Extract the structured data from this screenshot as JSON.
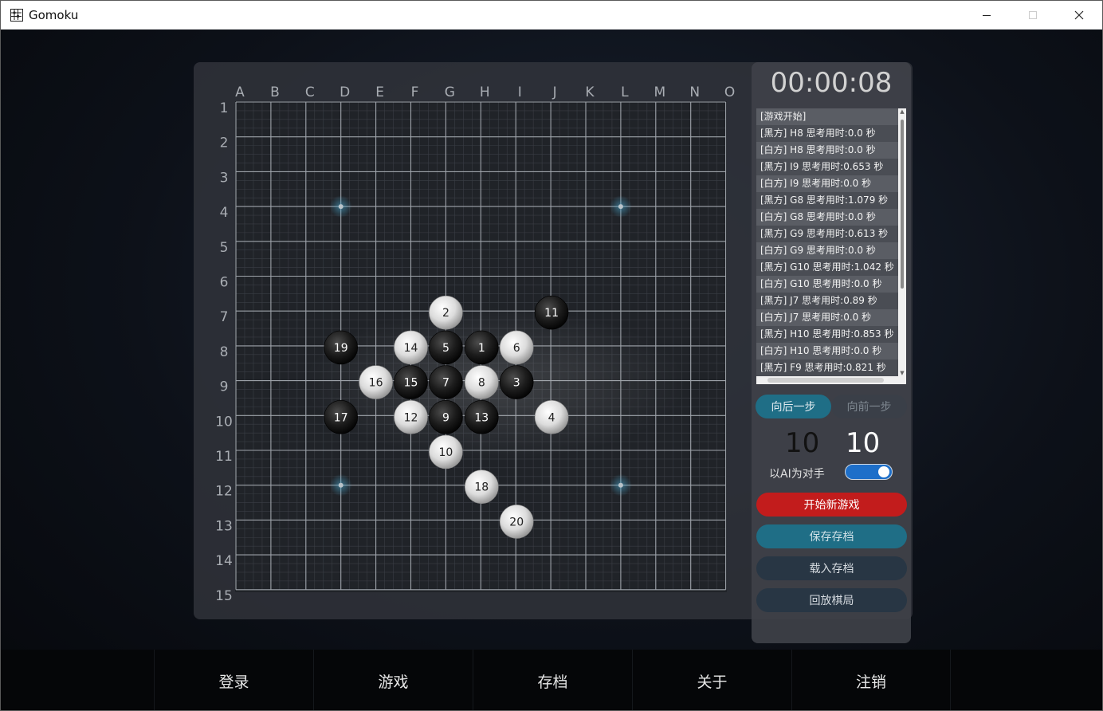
{
  "window": {
    "title": "Gomoku",
    "controls": {
      "minimize": "—",
      "maximize": "☐",
      "close": "✕"
    }
  },
  "board": {
    "columns": [
      "A",
      "B",
      "C",
      "D",
      "E",
      "F",
      "G",
      "H",
      "I",
      "J",
      "K",
      "L",
      "M",
      "N",
      "O"
    ],
    "rows": [
      "1",
      "2",
      "3",
      "4",
      "5",
      "6",
      "7",
      "8",
      "9",
      "10",
      "11",
      "12",
      "13",
      "14",
      "15"
    ],
    "star_points": [
      [
        "D",
        4
      ],
      [
        "L",
        4
      ],
      [
        "D",
        12
      ],
      [
        "L",
        12
      ]
    ],
    "stones": [
      {
        "n": 1,
        "color": "black",
        "col": "H",
        "row": 8
      },
      {
        "n": 2,
        "color": "white",
        "col": "G",
        "row": 7
      },
      {
        "n": 3,
        "color": "black",
        "col": "I",
        "row": 9
      },
      {
        "n": 4,
        "color": "white",
        "col": "J",
        "row": 10
      },
      {
        "n": 5,
        "color": "black",
        "col": "G",
        "row": 8
      },
      {
        "n": 6,
        "color": "white",
        "col": "I",
        "row": 8
      },
      {
        "n": 7,
        "color": "black",
        "col": "G",
        "row": 9
      },
      {
        "n": 8,
        "color": "white",
        "col": "H",
        "row": 9
      },
      {
        "n": 9,
        "color": "black",
        "col": "G",
        "row": 10
      },
      {
        "n": 10,
        "color": "white",
        "col": "G",
        "row": 11
      },
      {
        "n": 11,
        "color": "black",
        "col": "J",
        "row": 7
      },
      {
        "n": 12,
        "color": "white",
        "col": "F",
        "row": 10
      },
      {
        "n": 13,
        "color": "black",
        "col": "H",
        "row": 10
      },
      {
        "n": 14,
        "color": "white",
        "col": "F",
        "row": 8
      },
      {
        "n": 15,
        "color": "black",
        "col": "F",
        "row": 9
      },
      {
        "n": 16,
        "color": "white",
        "col": "E",
        "row": 9
      },
      {
        "n": 17,
        "color": "black",
        "col": "D",
        "row": 10
      },
      {
        "n": 18,
        "color": "white",
        "col": "H",
        "row": 12
      },
      {
        "n": 19,
        "color": "black",
        "col": "D",
        "row": 8
      },
      {
        "n": 20,
        "color": "white",
        "col": "I",
        "row": 13
      }
    ]
  },
  "side": {
    "timer": "00:00:08",
    "moves": [
      "[游戏开始]",
      "[黑方] H8  思考用时:0.0 秒",
      "[白方] H8  思考用时:0.0 秒",
      "[黑方] I9  思考用时:0.653 秒",
      "[白方] I9  思考用时:0.0 秒",
      "[黑方] G8  思考用时:1.079 秒",
      "[白方] G8  思考用时:0.0 秒",
      "[黑方] G9  思考用时:0.613 秒",
      "[白方] G9  思考用时:0.0 秒",
      "[黑方] G10  思考用时:1.042 秒",
      "[白方] G10  思考用时:0.0 秒",
      "[黑方] J7  思考用时:0.89 秒",
      "[白方] J7  思考用时:0.0 秒",
      "[黑方] H10  思考用时:0.853 秒",
      "[白方] H10  思考用时:0.0 秒",
      "[黑方] F9  思考用时:0.821 秒"
    ],
    "back_label": "向后一步",
    "forward_label": "向前一步",
    "score_black": "10",
    "score_white": "10",
    "ai_label": "以AI为对手",
    "ai_enabled": true,
    "new_game_label": "开始新游戏",
    "save_label": "保存存档",
    "load_label": "载入存档",
    "replay_label": "回放棋局"
  },
  "nav": {
    "login": "登录",
    "game": "游戏",
    "archive": "存档",
    "about": "关于",
    "logout": "注销"
  },
  "colors": {
    "accent_teal": "#1f6e86",
    "danger_red": "#c21c1c",
    "toggle_blue": "#1e6fc9"
  }
}
